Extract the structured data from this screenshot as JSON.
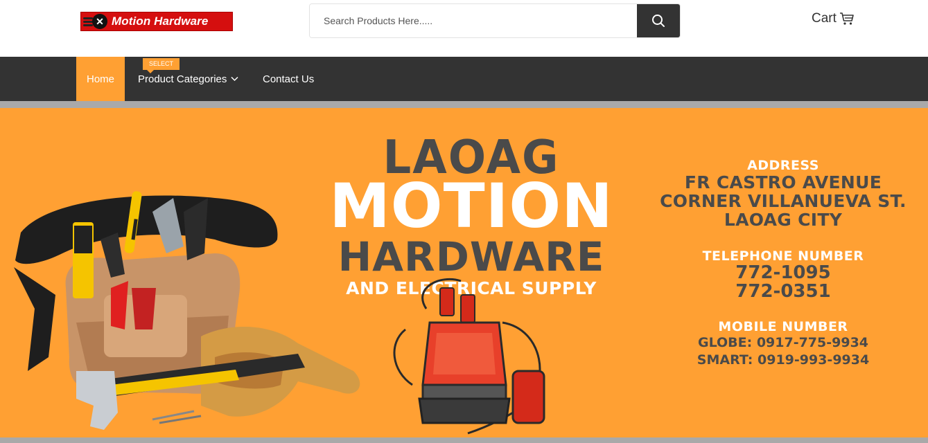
{
  "header": {
    "logo_text": "Motion Hardware",
    "search_placeholder": "Search Products Here.....",
    "cart_label": "Cart"
  },
  "nav": {
    "home": "Home",
    "categories": "Product Categories",
    "categories_badge": "SELECT",
    "contact": "Contact Us"
  },
  "banner": {
    "title_line1": "LAOAG",
    "title_line2": "MOTION",
    "title_line3": "HARDWARE",
    "title_line4": "AND ELECTRICAL SUPPLY",
    "address_label": "ADDRESS",
    "address_line1": "FR CASTRO AVENUE",
    "address_line2": "CORNER VILLANUEVA ST.",
    "address_line3": "LAOAG CITY",
    "telephone_label": "TELEPHONE NUMBER",
    "telephone_1": "772-1095",
    "telephone_2": "772-0351",
    "mobile_label": "MOBILE NUMBER",
    "mobile_globe": "GLOBE: 0917-775-9934",
    "mobile_smart": "SMART: 0919-993-9934"
  },
  "colors": {
    "accent_orange": "#ffa033",
    "nav_dark": "#333333",
    "logo_red": "#d50f0f",
    "text_gray": "#4a4a4a"
  },
  "icons": [
    "search-icon",
    "cart-icon",
    "chevron-down-icon"
  ]
}
